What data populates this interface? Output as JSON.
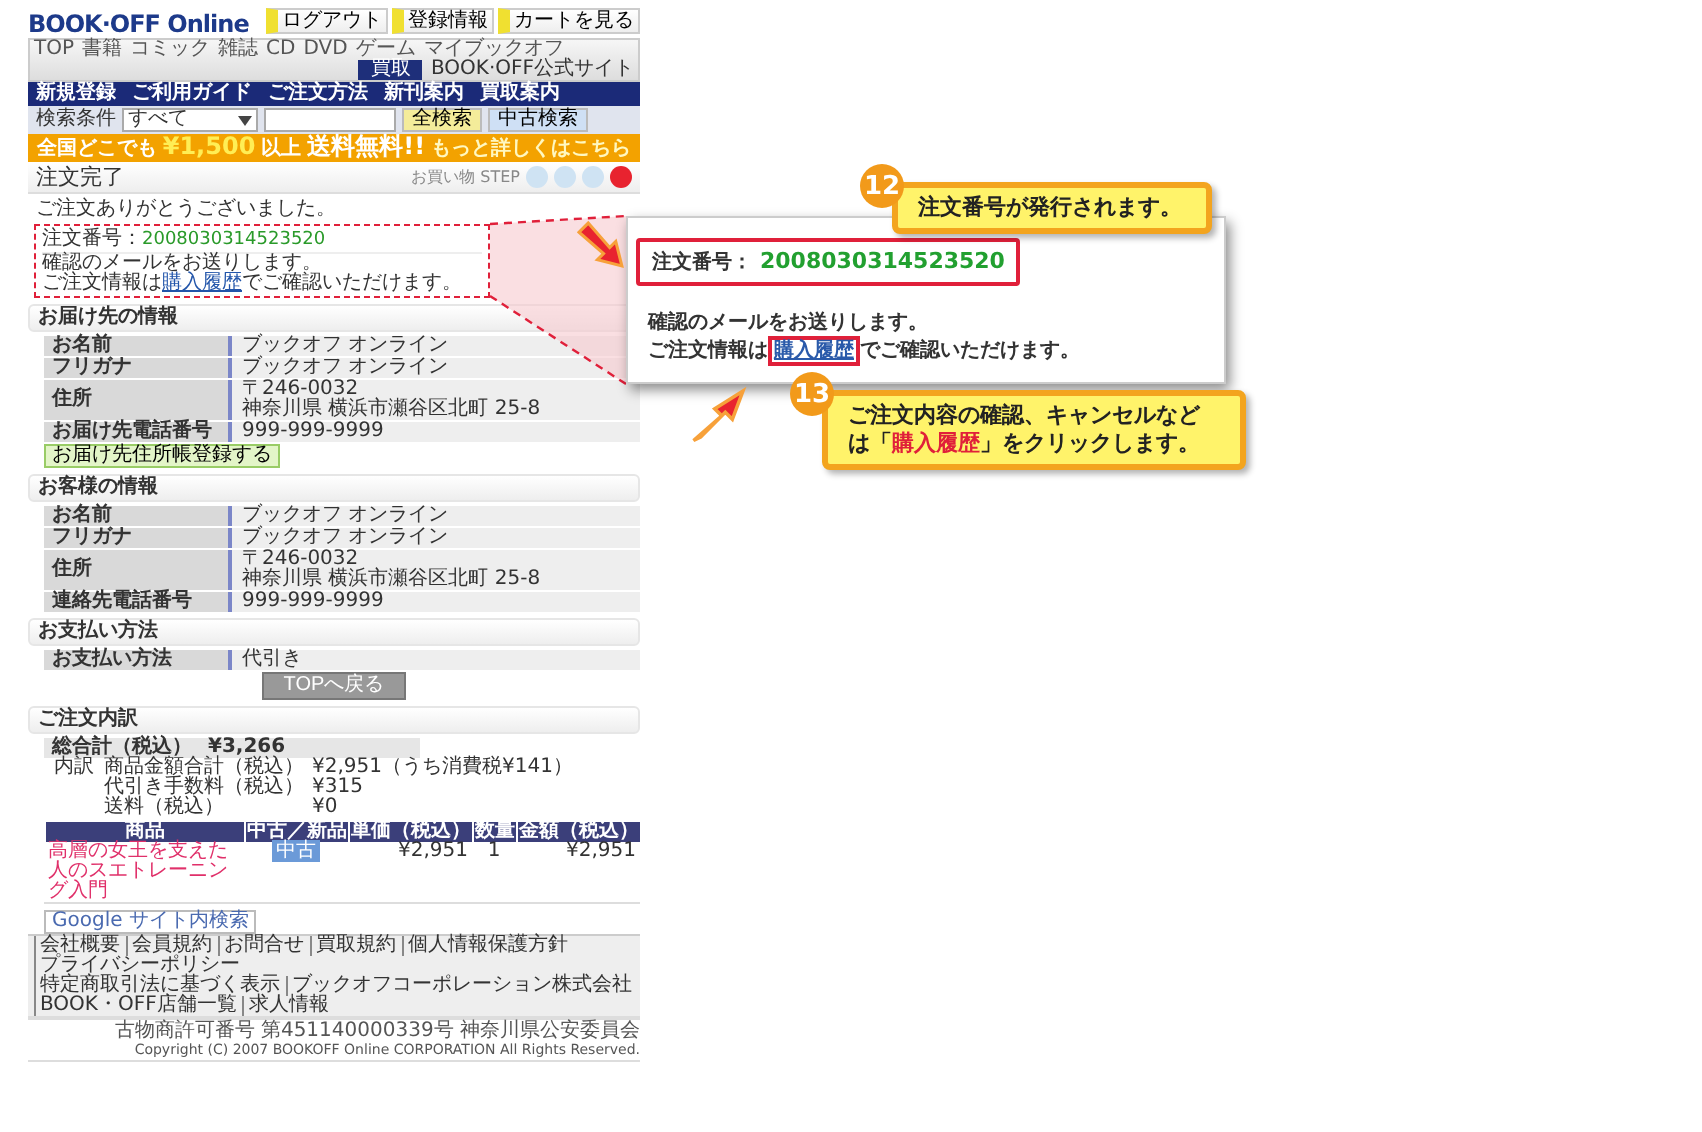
{
  "header": {
    "logo": "BOOK·OFF Online",
    "top_buttons": [
      "ログアウト",
      "登録情報",
      "カートを見る"
    ],
    "nav": [
      "TOP",
      "書籍",
      "コミック",
      "雑誌",
      "CD",
      "DVD",
      "ゲーム",
      "マイブックオフ"
    ],
    "nav_right": {
      "button": "買取",
      "link": "BOOK·OFF公式サイト"
    },
    "subnav": [
      "新規登録",
      "ご利用ガイド",
      "ご注文方法",
      "新刊案内",
      "買取案内"
    ],
    "search": {
      "label": "検索条件",
      "select": "すべて",
      "buttons": [
        "全検索",
        "中古検索"
      ]
    },
    "banner": {
      "lead": "全国どこでも",
      "amount": "¥1,500",
      "middle": "以上",
      "emphasis": "送料無料!!",
      "more": "もっと詳しくはこちら"
    }
  },
  "title": "注文完了",
  "steps_label": "お買い物 STEP",
  "steps": [
    {
      "selected": false
    },
    {
      "selected": false
    },
    {
      "selected": false
    },
    {
      "selected": true
    }
  ],
  "thanks": "ご注文ありがとうございました。",
  "order": {
    "label": "注文番号：",
    "number": "2008030314523520",
    "mail": "確認のメールをお送りします。",
    "info_before": "ご注文情報は",
    "info_link": "購入履歴",
    "info_after": "でご確認いただけます。"
  },
  "magnified": {
    "label": "注文番号：",
    "number": "2008030314523520",
    "mail": "確認のメールをお送りします。",
    "info_before": "ご注文情報は",
    "info_link": "購入履歴",
    "info_after": "でご確認いただけます。"
  },
  "delivery": {
    "title": "お届け先の情報",
    "rows": [
      {
        "label": "お名前",
        "lines": [
          "ブックオフ オンライン"
        ]
      },
      {
        "label": "フリガナ",
        "lines": [
          "ブックオフ オンライン"
        ]
      },
      {
        "label": "住所",
        "lines": [
          "〒246-0032",
          "神奈川県 横浜市瀬谷区北町 25-8"
        ]
      },
      {
        "label": "お届け先電話番号",
        "lines": [
          "999-999-9999"
        ]
      }
    ],
    "button": "お届け先住所帳登録する"
  },
  "customer": {
    "title": "お客様の情報",
    "rows": [
      {
        "label": "お名前",
        "lines": [
          "ブックオフ オンライン"
        ]
      },
      {
        "label": "フリガナ",
        "lines": [
          "ブックオフ オンライン"
        ]
      },
      {
        "label": "住所",
        "lines": [
          "〒246-0032",
          "神奈川県 横浜市瀬谷区北町 25-8"
        ]
      },
      {
        "label": "連絡先電話番号",
        "lines": [
          "999-999-9999"
        ]
      }
    ]
  },
  "payment": {
    "title": "お支払い方法",
    "rows": [
      {
        "label": "お支払い方法",
        "lines": [
          "代引き"
        ]
      }
    ],
    "button": "TOPへ戻る"
  },
  "breakdown": {
    "title": "ご注文内訳",
    "total_label": "総合計（税込）",
    "total": "¥3,266",
    "detail_label": "内訳",
    "details": [
      {
        "label": "商品金額合計（税込）",
        "value": "¥2,951（うち消費税¥141）"
      },
      {
        "label": "代引き手数料（税込）",
        "value": "¥315"
      },
      {
        "label": "送料（税込）",
        "value": "¥0"
      }
    ]
  },
  "items": {
    "columns": [
      "商品",
      "中古／新品",
      "単価（税込）",
      "数量",
      "金額（税込）"
    ],
    "rows": [
      {
        "title": "高層の女王を支えた人のスエトレーニング入門",
        "condition": "中古",
        "price": "¥2,951",
        "qty": "1",
        "amount": "¥2,951"
      }
    ]
  },
  "footer": {
    "search": "Google サイト内検索",
    "links": [
      [
        "会社概要",
        "会員規約",
        "お問合せ",
        "買取規約",
        "個人情報保護方針",
        "プライバシーポリシー"
      ],
      [
        "特定商取引法に基づく表示",
        "ブックオフコーポレーション株式会社",
        "BOOK・OFF店舗一覧",
        "求人情報"
      ]
    ],
    "license": "古物商許可番号 第451140000339号 神奈川県公安委員会",
    "copyright": "Copyright (C) 2007 BOOKOFF Online CORPORATION All Rights Reserved."
  },
  "callouts": [
    {
      "number": "12",
      "text": "注文番号が発行されます。"
    },
    {
      "number": "13",
      "before": "ご注文内容の確認、キャンセルなどは「",
      "highlight": "購入履歴",
      "after": "」をクリックします。"
    }
  ]
}
